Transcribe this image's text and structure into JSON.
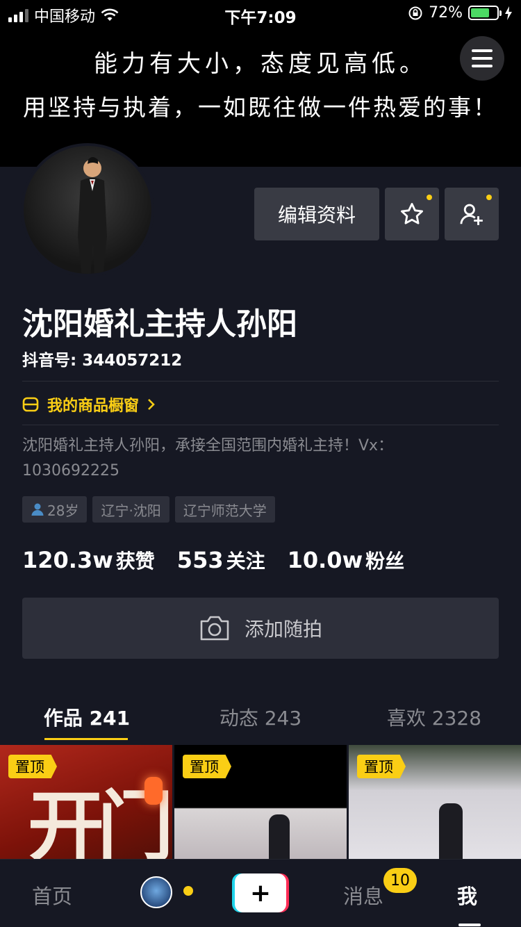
{
  "status_bar": {
    "carrier": "中国移动",
    "time": "下午7:09",
    "battery_percent": "72%",
    "battery_level": 0.72
  },
  "banner": {
    "line1": "能力有大小，态度见高低。",
    "line2": "用坚持与执着，一如既往做一件热爱的事！"
  },
  "profile": {
    "edit_label": "编辑资料",
    "name": "沈阳婚礼主持人孙阳",
    "douyin_id": "抖音号: 344057212",
    "shop_label": "我的商品橱窗",
    "bio": "沈阳婚礼主持人孙阳，承接全国范围内婚礼主持！Vx：1030692225",
    "tags": [
      "28岁",
      "辽宁·沈阳",
      "辽宁师范大学"
    ],
    "stats": [
      {
        "num": "120.3w",
        "label": "获赞"
      },
      {
        "num": "553",
        "label": "关注"
      },
      {
        "num": "10.0w",
        "label": "粉丝"
      }
    ],
    "add_photo_label": "添加随拍"
  },
  "tabs": [
    {
      "label": "作品 241",
      "active": true
    },
    {
      "label": "动态 243",
      "active": false
    },
    {
      "label": "喜欢 2328",
      "active": false
    }
  ],
  "grid": {
    "pin_label": "置顶",
    "cell1_text": "开门"
  },
  "bottom_nav": {
    "home": "首页",
    "plus": "+",
    "messages": "消息",
    "message_badge": "10",
    "me": "我"
  },
  "colors": {
    "accent": "#face15",
    "background": "#161823",
    "card": "#2d2f3a"
  }
}
